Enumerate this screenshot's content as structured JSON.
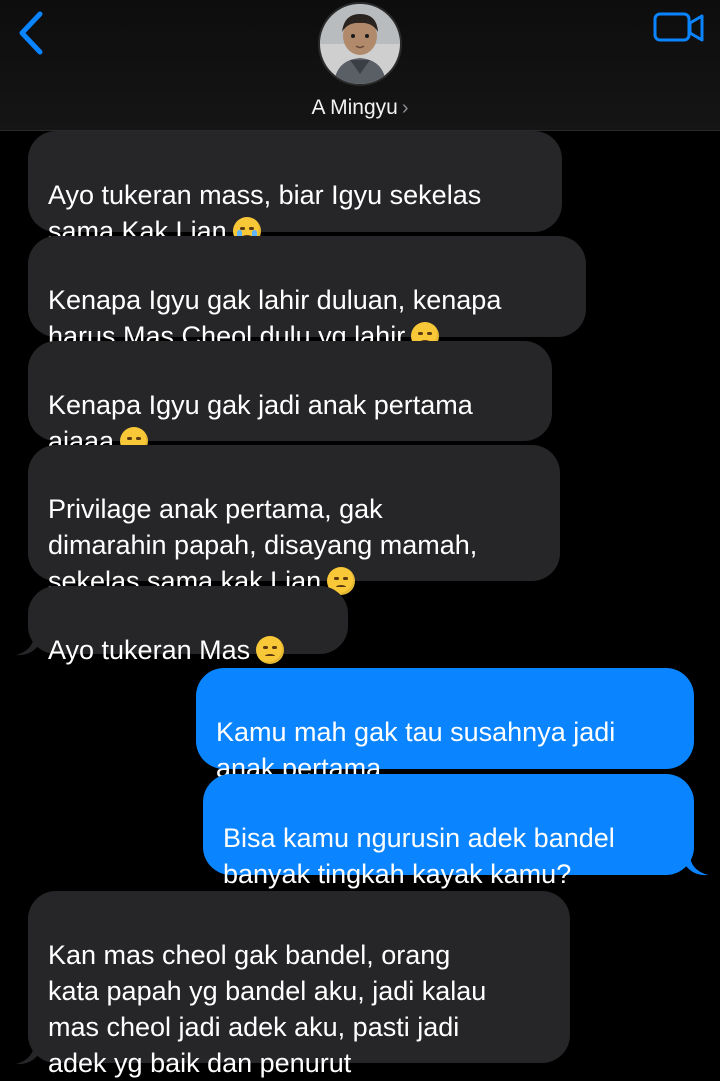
{
  "header": {
    "contact_name": "A Mingyu",
    "chevron": "›",
    "back_icon": "chevron-left-icon",
    "video_icon": "video-camera-icon",
    "accent": "#0a84ff"
  },
  "messages": [
    {
      "direction": "incoming",
      "text": "Ayo tukeran mass, biar Igyu sekelas\nsama Kak Lian",
      "emoji": "loudly-crying-face"
    },
    {
      "direction": "incoming",
      "text": "Kenapa Igyu gak lahir duluan, kenapa\nharus Mas Cheol dulu yg lahir",
      "emoji": "pensive-face"
    },
    {
      "direction": "incoming",
      "text": "Kenapa Igyu gak jadi anak pertama\najaaa",
      "emoji": "face-with-steam-from-nose"
    },
    {
      "direction": "incoming",
      "text": "Privilage anak pertama, gak\ndimarahin papah, disayang mamah,\nsekelas sama kak Lian",
      "emoji": "disappointed-face"
    },
    {
      "direction": "incoming",
      "text": "Ayo tukeran Mas",
      "emoji": "disappointed-face"
    },
    {
      "direction": "outgoing",
      "text": "Kamu mah gak tau susahnya jadi\nanak pertama"
    },
    {
      "direction": "outgoing",
      "text": "Bisa kamu ngurusin adek bandel\nbanyak tingkah kayak kamu?"
    },
    {
      "direction": "incoming",
      "text": "Kan mas cheol gak bandel, orang\nkata papah yg bandel aku, jadi kalau\nmas cheol jadi adek aku, pasti jadi\nadek yg baik dan penurut"
    }
  ]
}
